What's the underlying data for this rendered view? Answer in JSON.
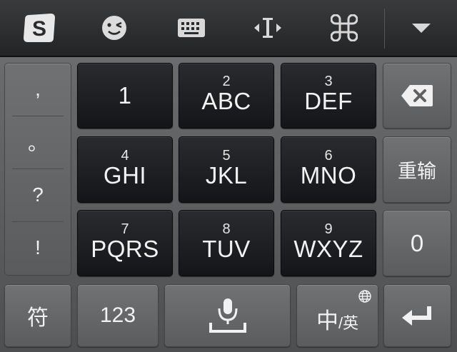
{
  "toolbar": {
    "icons": [
      "sogou-logo-icon",
      "emoji-icon",
      "keyboard-icon",
      "cursor-move-icon",
      "command-icon",
      "collapse-arrow-icon"
    ]
  },
  "punctuation": [
    ",",
    "。",
    "?",
    "!"
  ],
  "keys": {
    "k1": {
      "letters": "1"
    },
    "k2": {
      "num": "2",
      "letters": "ABC"
    },
    "k3": {
      "num": "3",
      "letters": "DEF"
    },
    "k4": {
      "num": "4",
      "letters": "GHI"
    },
    "k5": {
      "num": "5",
      "letters": "JKL"
    },
    "k6": {
      "num": "6",
      "letters": "MNO"
    },
    "k7": {
      "num": "7",
      "letters": "PQRS"
    },
    "k8": {
      "num": "8",
      "letters": "TUV"
    },
    "k9": {
      "num": "9",
      "letters": "WXYZ"
    },
    "zero": "0",
    "reinput": "重输",
    "symbol": "符",
    "numeric": "123",
    "lang_main": "中",
    "lang_alt": "/英"
  },
  "colors": {
    "dark_key": "#1e1f22",
    "light_key": "#656769",
    "text": "#f2f2f2"
  }
}
